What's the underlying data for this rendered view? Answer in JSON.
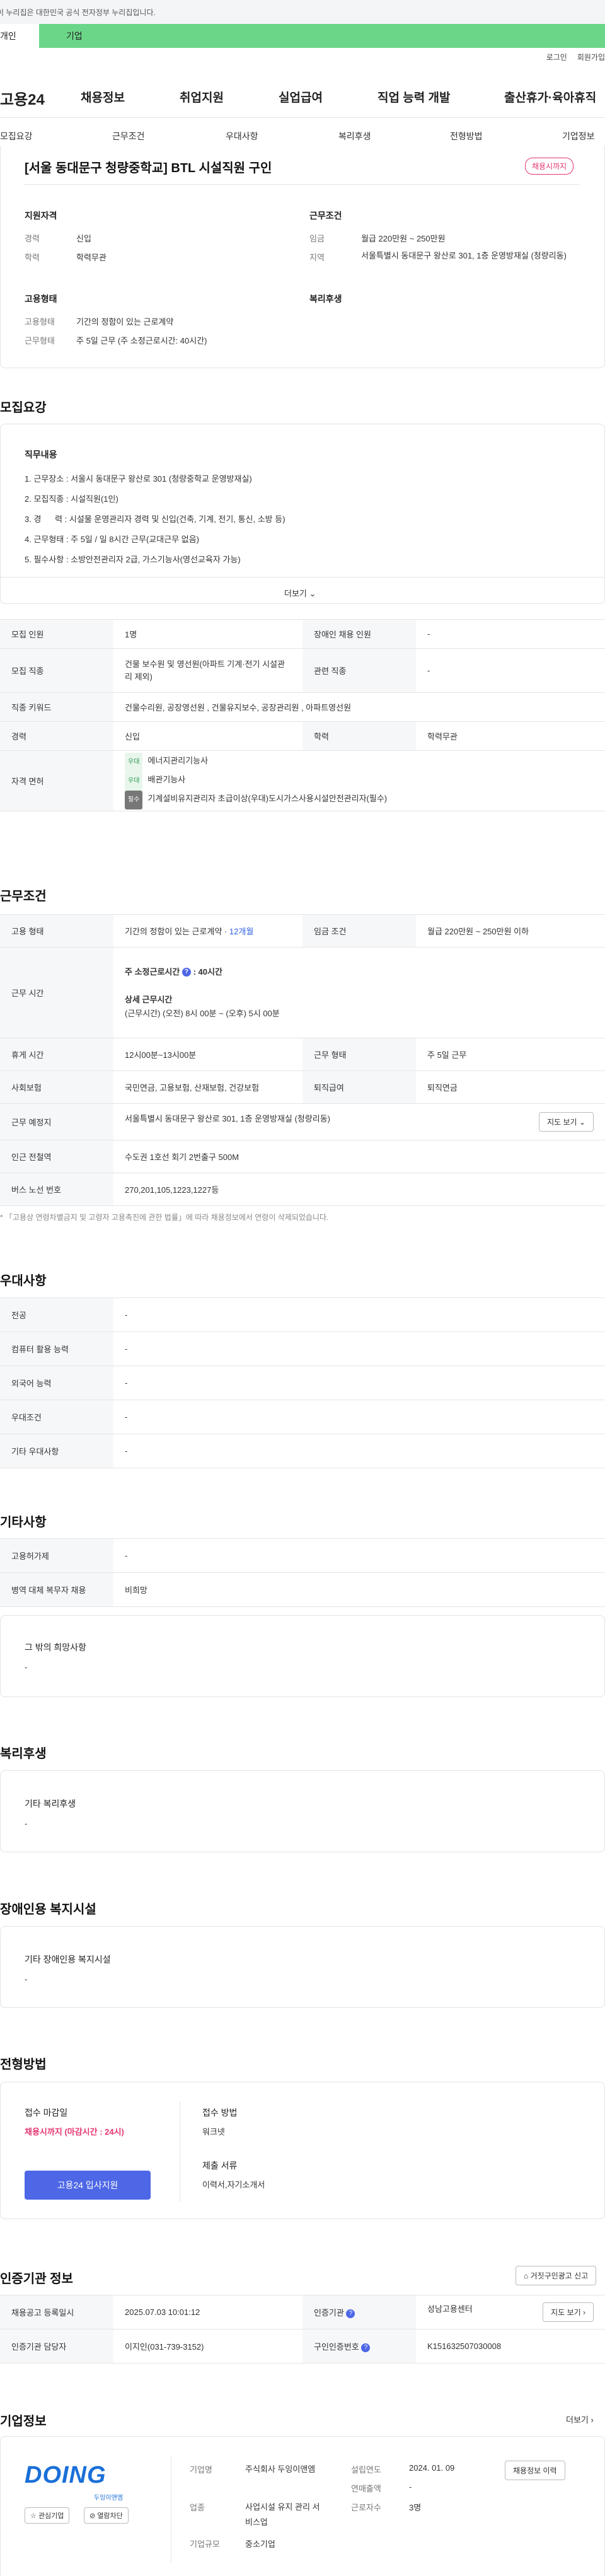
{
  "gov_banner": "이 누리집은 대한민국 공식 전자정부 누리집입니다.",
  "tabs": [
    "개인",
    "기업"
  ],
  "util": [
    "로그인",
    "회원가입"
  ],
  "logo": "고용24",
  "gnb": [
    "채용정보",
    "취업지원",
    "실업급여",
    "직업 능력 개발",
    "출산휴가·육아휴직"
  ],
  "subnav": [
    "모집요강",
    "근무조건",
    "우대사항",
    "복리후생",
    "전형방법",
    "기업정보"
  ],
  "job": {
    "title": "[서울 동대문구 청량중학교] BTL 시설직원 구인",
    "badge": "채용시까지",
    "qual_title": "지원자격",
    "cond_title": "근무조건",
    "career_lbl": "경력",
    "career": "신입",
    "edu_lbl": "학력",
    "edu": "학력무관",
    "wage_lbl": "임금",
    "wage": "월급 220만원 ~ 250만원",
    "region_lbl": "지역",
    "region": "서울특별시 동대문구 왕산로 301, 1층 운영방재실 (청량리동)",
    "emp_title": "고용형태",
    "welfare_title": "복리후생",
    "emptype_lbl": "고용형태",
    "emptype": "기간의 정함이 있는 근로계약",
    "worktype_lbl": "근무형태",
    "worktype": "주 5일 근무 (주 소정근로시간: 40시간)"
  },
  "recruit": {
    "title": "모집요강",
    "duty_title": "직무내용",
    "duties": [
      "1. 근무장소 : 서울시 동대문구 왕산로 301 (청량중학교 운영방재실)",
      "2. 모집직종 : 시설직원(1인)",
      "3. 경      력 : 시설물 운영관리자 경력 및 신입(건축, 기계, 전기, 통신, 소방 등)",
      "4. 근무형태 : 주 5일 / 일 8시간 근무(교대근무 없음)",
      "5. 필수사항 : 소방안전관리자 2급, 가스기능사(영선교육자 가능)"
    ],
    "more": "더보기",
    "rows": {
      "count_l": "모집 인원",
      "count": "1명",
      "disab_l": "장애인 채용 인원",
      "disab": "-",
      "job_l": "모집 직종",
      "job": "건물 보수원 및 영선원(아파트 기계·전기 시설관리 제외)",
      "rel_l": "관련 직종",
      "rel": "-",
      "kw_l": "직종 키워드",
      "kw": "건물수리원, 공장영선원 , 건물유지보수, 공장관리원 , 아파트영선원",
      "career_l": "경력",
      "career": "신입",
      "edu_l": "학력",
      "edu": "학력무관",
      "lic_l": "자격 면허",
      "licenses": [
        {
          "tag": "우대",
          "name": "에너지관리기능사"
        },
        {
          "tag": "우대",
          "name": "배관기능사"
        },
        {
          "tag": "필수",
          "name": "기계설비유지관리자 초급이상(우대)도시가스사용시설안전관리자(필수)"
        }
      ]
    }
  },
  "work": {
    "title": "근무조건",
    "emp_l": "고용 형태",
    "emp": "기간의 정함이 있는 근로계약 · ",
    "emp_months": "12개월",
    "wage_l": "임금 조건",
    "wage": "월급 220만원 ~ 250만원 이하",
    "hours_l": "근무 시간",
    "hours_title": "주 소정근로시간",
    "hours_val": "40시간",
    "detail_title": "상세 근무시간",
    "detail": "(근무시간) (오전) 8시 00분 ~ (오후) 5시 00분",
    "rest_l": "휴게 시간",
    "rest": "12시00분~13시00분",
    "form_l": "근무 형태",
    "form": "주 5일 근무",
    "ins_l": "사회보험",
    "ins": "국민연금, 고용보험, 산재보험, 건강보험",
    "ret_l": "퇴직급여",
    "ret": "퇴직연금",
    "place_l": "근무 예정지",
    "place": "서울특별시 동대문구 왕산로 301, 1층 운영방재실 (청량리동)",
    "map": "지도 보기",
    "subway_l": "인근 전철역",
    "subway": "수도권 1호선 회기 2번출구 500M",
    "bus_l": "버스 노선 번호",
    "bus": "270,201,105,1223,1227등",
    "note": "* 「고용상 연령차별금지 및 고령자 고용촉진에 관한 법률」에 따라 채용정보에서 연령이 삭제되었습니다."
  },
  "pref": {
    "title": "우대사항",
    "rows": [
      [
        "전공",
        "-"
      ],
      [
        "컴퓨터 활용 능력",
        "-"
      ],
      [
        "외국어 능력",
        "-"
      ],
      [
        "우대조건",
        "-"
      ],
      [
        "기타 우대사항",
        "-"
      ]
    ]
  },
  "etc": {
    "title": "기타사항",
    "rows": [
      [
        "고용허가제",
        "-"
      ],
      [
        "병역 대체 복무자 채용",
        "비희망"
      ]
    ],
    "other_title": "그 밖의 희망사항",
    "other": "-"
  },
  "welfare": {
    "title": "복리후생",
    "sub": "기타 복리후생",
    "val": "-"
  },
  "disability": {
    "title": "장애인용 복지시설",
    "sub": "기타 장애인용 복지시설",
    "val": "-"
  },
  "process": {
    "title": "전형방법",
    "deadline_t": "접수 마감일",
    "deadline": "채용시까지 (마감시간 : 24시)",
    "apply_btn": "고용24 입사지원",
    "method_t": "접수 방법",
    "method": "워크넷",
    "docs_t": "제출 서류",
    "docs": "이력서,자기소개서"
  },
  "agency": {
    "title": "인증기관 정보",
    "report": "거짓구인광고 신고",
    "reg_l": "채용공고 등록일시",
    "reg": "2025.07.03 10:01:12",
    "org_l": "인증기관",
    "org": "성남고용센터",
    "map": "지도 보기",
    "mgr_l": "인증기관 담당자",
    "mgr": "이지인(031-739-3152)",
    "no_l": "구인인증번호",
    "no": "K151632507030008"
  },
  "company": {
    "title": "기업정보",
    "more": "더보기",
    "logo": "DOING",
    "logo_sub": "두잉이앤엠",
    "fav": "관심기업",
    "block": "열람차단",
    "name_l": "기업명",
    "name": "주식회사 두잉이앤엠",
    "ind_l": "업종",
    "ind": "사업시설 유지 관리 서비스업",
    "size_l": "기업규모",
    "size": "중소기업",
    "est_l": "설립연도",
    "est": "2024. 01. 09",
    "sales_l": "연매출액",
    "sales": "-",
    "emp_l": "근로자수",
    "emp": "3명",
    "info_btn": "채용정보 이력"
  },
  "colors": {
    "green": "#6bd688",
    "pink": "#e53570",
    "blue": "#4d67e6"
  }
}
